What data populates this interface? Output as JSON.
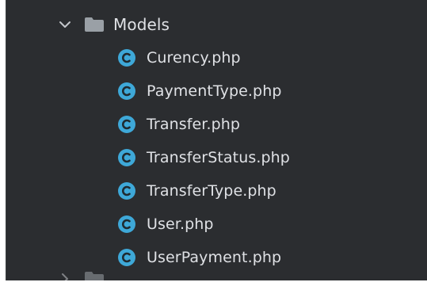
{
  "tree": {
    "folder": {
      "name": "Models",
      "expanded": true,
      "icon": "folder-icon"
    },
    "files": [
      {
        "name": "Curency.php",
        "icon": "php-class-icon"
      },
      {
        "name": "PaymentType.php",
        "icon": "php-class-icon"
      },
      {
        "name": "Transfer.php",
        "icon": "php-class-icon"
      },
      {
        "name": "TransferStatus.php",
        "icon": "php-class-icon"
      },
      {
        "name": "TransferType.php",
        "icon": "php-class-icon"
      },
      {
        "name": "User.php",
        "icon": "php-class-icon"
      },
      {
        "name": "UserPayment.php",
        "icon": "php-class-icon"
      }
    ]
  },
  "colors": {
    "background": "#2b2d30",
    "text": "#dfe1e5",
    "class_icon": "#3ea8d8",
    "folder_icon": "#9aa0a6"
  }
}
